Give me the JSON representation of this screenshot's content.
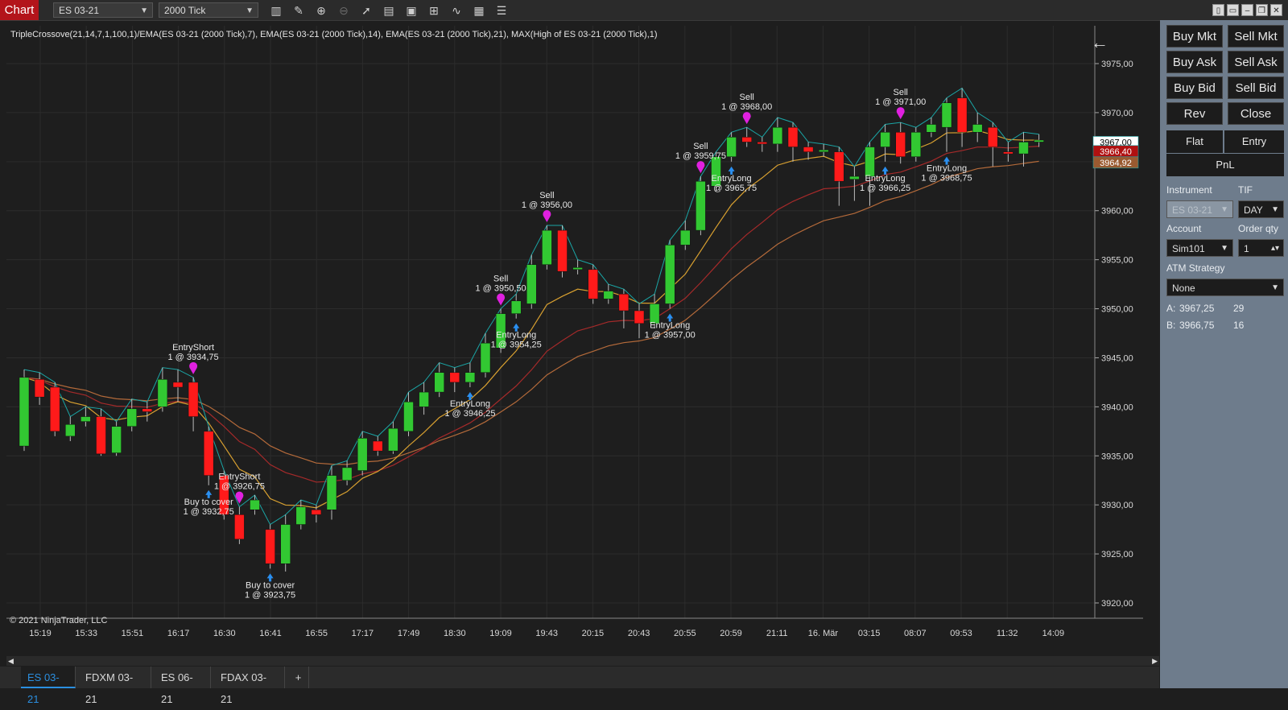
{
  "app": {
    "label": "Chart"
  },
  "toolbar": {
    "instrument": "ES 03-21",
    "interval": "2000 Tick"
  },
  "chart": {
    "indicator_label": "TripleCrossove(21,14,7,1,100,1)/EMA(ES 03-21 (2000 Tick),7), EMA(ES 03-21 (2000 Tick),14), EMA(ES 03-21 (2000 Tick),21), MAX(High of ES 03-21 (2000 Tick),1)",
    "copyright": "© 2021 NinjaTrader, LLC",
    "price_markers": {
      "last": "3967,00",
      "red": "3966,40",
      "brown": "3964,92"
    }
  },
  "chart_data": {
    "type": "candlestick",
    "ylim": [
      3918,
      3978
    ],
    "y_ticks": [
      "3920,00",
      "3925,00",
      "3930,00",
      "3935,00",
      "3940,00",
      "3945,00",
      "3950,00",
      "3955,00",
      "3960,00",
      "3965,00",
      "3970,00",
      "3975,00"
    ],
    "x_ticks": [
      "15:19",
      "15:33",
      "15:51",
      "16:17",
      "16:30",
      "16:41",
      "16:55",
      "17:17",
      "17:49",
      "18:30",
      "19:09",
      "19:43",
      "20:15",
      "20:43",
      "20:55",
      "20:59",
      "21:11",
      "16. Mär",
      "03:15",
      "08:07",
      "09:53",
      "11:32",
      "14:09"
    ],
    "candles": [
      [
        3936.0,
        3943.0,
        3943.8,
        3935.5
      ],
      [
        3942.8,
        3941.0,
        3943.5,
        3940.2
      ],
      [
        3942.0,
        3937.5,
        3942.5,
        3937.0
      ],
      [
        3937.0,
        3938.2,
        3939.0,
        3936.5
      ],
      [
        3938.5,
        3939.0,
        3940.0,
        3938.0
      ],
      [
        3939.0,
        3935.2,
        3939.8,
        3935.0
      ],
      [
        3935.3,
        3938.0,
        3938.5,
        3935.0
      ],
      [
        3938.0,
        3939.8,
        3940.8,
        3937.5
      ],
      [
        3939.8,
        3939.5,
        3940.5,
        3938.5
      ],
      [
        3940.0,
        3942.8,
        3944.0,
        3939.5
      ],
      [
        3942.5,
        3942.0,
        3943.8,
        3940.5
      ],
      [
        3942.5,
        3939.0,
        3943.0,
        3937.5
      ],
      [
        3937.5,
        3933.0,
        3938.0,
        3932.0
      ],
      [
        3933.0,
        3929.0,
        3933.5,
        3928.5
      ],
      [
        3929.0,
        3926.5,
        3929.8,
        3926.0
      ],
      [
        3929.5,
        3930.5,
        3931.0,
        3929.0
      ],
      [
        3927.5,
        3924.0,
        3928.0,
        3923.5
      ],
      [
        3924.0,
        3928.0,
        3929.0,
        3923.2
      ],
      [
        3928.0,
        3929.8,
        3930.5,
        3927.5
      ],
      [
        3929.5,
        3929.0,
        3930.0,
        3928.2
      ],
      [
        3929.5,
        3933.0,
        3934.0,
        3928.5
      ],
      [
        3932.5,
        3933.8,
        3934.5,
        3932.0
      ],
      [
        3933.5,
        3936.8,
        3937.5,
        3933.0
      ],
      [
        3936.5,
        3935.5,
        3937.0,
        3935.0
      ],
      [
        3935.5,
        3937.8,
        3938.5,
        3935.2
      ],
      [
        3937.5,
        3940.5,
        3941.5,
        3937.0
      ],
      [
        3940.0,
        3941.5,
        3942.5,
        3939.2
      ],
      [
        3941.5,
        3943.5,
        3944.5,
        3941.0
      ],
      [
        3943.5,
        3942.5,
        3944.0,
        3941.5
      ],
      [
        3942.5,
        3943.5,
        3944.5,
        3942.0
      ],
      [
        3943.5,
        3946.5,
        3947.5,
        3943.0
      ],
      [
        3946.0,
        3949.5,
        3950.0,
        3945.5
      ],
      [
        3949.5,
        3950.8,
        3951.5,
        3949.0
      ],
      [
        3950.5,
        3954.5,
        3955.5,
        3950.0
      ],
      [
        3954.5,
        3958.0,
        3958.5,
        3954.0
      ],
      [
        3958.0,
        3953.8,
        3958.5,
        3953.2
      ],
      [
        3954.0,
        3954.2,
        3955.0,
        3953.5
      ],
      [
        3954.0,
        3951.0,
        3954.5,
        3950.5
      ],
      [
        3951.0,
        3951.8,
        3952.5,
        3950.5
      ],
      [
        3951.5,
        3949.8,
        3952.0,
        3948.0
      ],
      [
        3949.8,
        3948.5,
        3950.5,
        3947.0
      ],
      [
        3948.5,
        3950.5,
        3951.5,
        3948.0
      ],
      [
        3950.5,
        3956.5,
        3957.0,
        3950.0
      ],
      [
        3956.5,
        3958.0,
        3959.0,
        3956.0
      ],
      [
        3958.0,
        3963.0,
        3963.5,
        3957.5
      ],
      [
        3962.5,
        3965.5,
        3966.0,
        3962.0
      ],
      [
        3965.5,
        3967.5,
        3968.0,
        3965.0
      ],
      [
        3967.5,
        3967.0,
        3968.5,
        3966.5
      ],
      [
        3967.0,
        3966.8,
        3967.5,
        3966.0
      ],
      [
        3966.8,
        3968.5,
        3969.5,
        3966.0
      ],
      [
        3968.5,
        3966.5,
        3969.0,
        3965.0
      ],
      [
        3966.5,
        3966.0,
        3967.0,
        3965.2
      ],
      [
        3966.0,
        3966.2,
        3966.8,
        3965.5
      ],
      [
        3966.0,
        3963.0,
        3966.5,
        3960.5
      ],
      [
        3963.2,
        3963.5,
        3964.5,
        3961.0
      ],
      [
        3963.5,
        3966.5,
        3967.0,
        3960.5
      ],
      [
        3966.5,
        3968.0,
        3968.8,
        3965.0
      ],
      [
        3968.0,
        3965.5,
        3969.0,
        3964.8
      ],
      [
        3965.5,
        3968.0,
        3968.5,
        3965.0
      ],
      [
        3968.0,
        3968.8,
        3969.5,
        3967.5
      ],
      [
        3968.5,
        3971.0,
        3971.5,
        3966.0
      ],
      [
        3971.5,
        3968.0,
        3972.5,
        3966.5
      ],
      [
        3968.0,
        3968.8,
        3970.0,
        3967.0
      ],
      [
        3968.5,
        3966.5,
        3969.0,
        3964.5
      ],
      [
        3966.0,
        3965.8,
        3967.0,
        3965.0
      ],
      [
        3965.8,
        3967.0,
        3968.0,
        3964.5
      ],
      [
        3967.0,
        3967.2,
        3967.8,
        3966.5
      ]
    ],
    "trades": [
      {
        "type": "EntryShort",
        "price": "3934,75",
        "bar": 11
      },
      {
        "type": "EntryShort",
        "price": "3926,75",
        "bar": 14
      },
      {
        "type": "Buy to cover",
        "price": "3932,75",
        "bar": 12
      },
      {
        "type": "Buy to cover",
        "price": "3923,75",
        "bar": 16
      },
      {
        "type": "EntryLong",
        "price": "3946,25",
        "bar": 29
      },
      {
        "type": "EntryLong",
        "price": "3954,25",
        "bar": 32
      },
      {
        "type": "Sell",
        "price": "3950,50",
        "bar": 31
      },
      {
        "type": "Sell",
        "price": "3956,00",
        "bar": 34
      },
      {
        "type": "EntryLong",
        "price": "3957,00",
        "bar": 42
      },
      {
        "type": "EntryLong",
        "price": "3965,75",
        "bar": 46
      },
      {
        "type": "Sell",
        "price": "3959,75",
        "bar": 44
      },
      {
        "type": "Sell",
        "price": "3968,00",
        "bar": 47
      },
      {
        "type": "EntryLong",
        "price": "3966,25",
        "bar": 56
      },
      {
        "type": "EntryLong",
        "price": "3968,75",
        "bar": 60
      },
      {
        "type": "Sell",
        "price": "3971,00",
        "bar": 57
      }
    ]
  },
  "tabs": [
    {
      "label": "ES 03-21"
    },
    {
      "label": "FDXM 03-21"
    },
    {
      "label": "ES 06-21"
    },
    {
      "label": "FDAX 03-21"
    },
    {
      "label": "+"
    }
  ],
  "sidebar": {
    "buy_mkt": "Buy Mkt",
    "sell_mkt": "Sell Mkt",
    "buy_ask": "Buy Ask",
    "sell_ask": "Sell Ask",
    "buy_bid": "Buy Bid",
    "sell_bid": "Sell Bid",
    "rev": "Rev",
    "close": "Close",
    "flat": "Flat",
    "entry": "Entry",
    "pnl": "PnL",
    "instrument_label": "Instrument",
    "tif_label": "TIF",
    "instrument_value": "ES 03-21",
    "tif_value": "DAY",
    "account_label": "Account",
    "order_qty_label": "Order qty",
    "account_value": "Sim101",
    "qty_value": "1",
    "atm_label": "ATM Strategy",
    "atm_value": "None",
    "ask_label": "A:",
    "ask_price": "3967,25",
    "ask_size": "29",
    "bid_label": "B:",
    "bid_price": "3966,75",
    "bid_size": "16"
  }
}
